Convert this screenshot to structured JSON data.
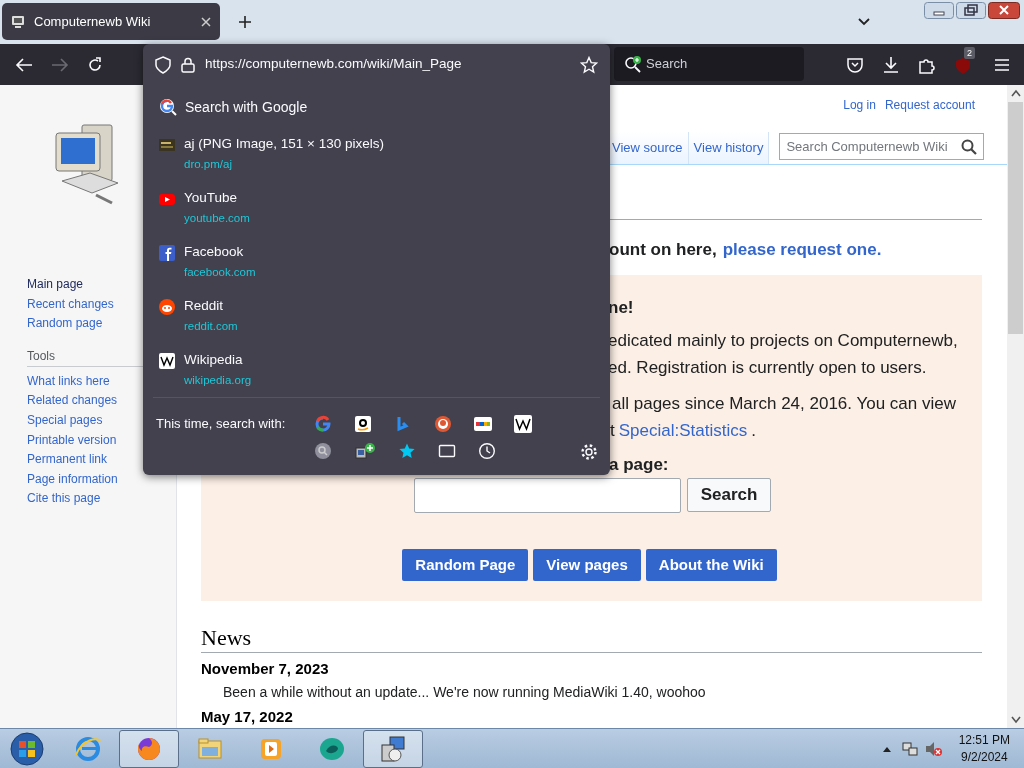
{
  "browser": {
    "tabs": [
      {
        "title": "Computernewb Wiki",
        "selected": true
      }
    ],
    "address_bar": {
      "url": "https://computernewb.com/wiki/Main_Page"
    },
    "search_box": {
      "placeholder": "Search"
    },
    "extension_badge": "2"
  },
  "url_dropdown": {
    "search_suggestion": "Search with Google",
    "results": [
      {
        "kind": "image",
        "title": "aj (PNG Image, 151 × 130 pixels)",
        "url": "dro.pm/aj"
      },
      {
        "kind": "youtube",
        "title": "YouTube",
        "url": "youtube.com"
      },
      {
        "kind": "facebook",
        "title": "Facebook",
        "url": "facebook.com"
      },
      {
        "kind": "reddit",
        "title": "Reddit",
        "url": "reddit.com"
      },
      {
        "kind": "wikipedia",
        "title": "Wikipedia",
        "url": "wikipedia.org"
      }
    ],
    "one_off_label": "This time, search with:"
  },
  "wiki": {
    "sidebar": {
      "navigation": [
        "Main page",
        "Recent changes",
        "Random page"
      ],
      "tools_heading": "Tools",
      "tools": [
        "What links here",
        "Related changes",
        "Special pages",
        "Printable version",
        "Permanent link",
        "Page information",
        "Cite this page"
      ]
    },
    "personal_links": [
      "Log in",
      "Request account"
    ],
    "view_tabs": [
      "View source",
      "View history"
    ],
    "search": {
      "placeholder": "Search Computernewb Wiki"
    },
    "notice": [
      {
        "kind": "text",
        "text": "ount on here,"
      },
      {
        "kind": "link",
        "text": "please request one."
      }
    ],
    "welcome": {
      "heading": "ne!",
      "lines": [
        [
          {
            "kind": "text",
            "text": "edicated mainly to projects on Computernewb,"
          }
        ],
        [
          {
            "kind": "text",
            "text": "ed. Registration is currently open to users."
          }
        ],
        [
          {
            "kind": "text",
            "text": "all pages since March 24, 2016. You can view"
          }
        ],
        [
          {
            "kind": "text",
            "text": "t"
          },
          {
            "kind": "link",
            "text": "Special:Statistics"
          },
          {
            "kind": "text",
            "text": "."
          }
        ]
      ],
      "search_prompt": "a page:",
      "search_button": "Search",
      "buttons": [
        "Random Page",
        "View pages",
        "About the Wiki"
      ]
    },
    "news": {
      "heading": "News",
      "items": [
        {
          "date": "November 7, 2023",
          "text": "Been a while without an update... We're now running MediaWiki 1.40, woohoo"
        },
        {
          "date": "May 17, 2022"
        }
      ]
    }
  },
  "taskbar": {
    "apps": [
      {
        "kind": "ie",
        "active": false
      },
      {
        "kind": "firefox",
        "active": true
      },
      {
        "kind": "explorer",
        "active": false
      },
      {
        "kind": "media",
        "active": false
      },
      {
        "kind": "teal",
        "active": false
      },
      {
        "kind": "installer",
        "active": true
      }
    ],
    "clock": {
      "time": "12:51 PM",
      "date": "9/2/2024"
    }
  }
}
